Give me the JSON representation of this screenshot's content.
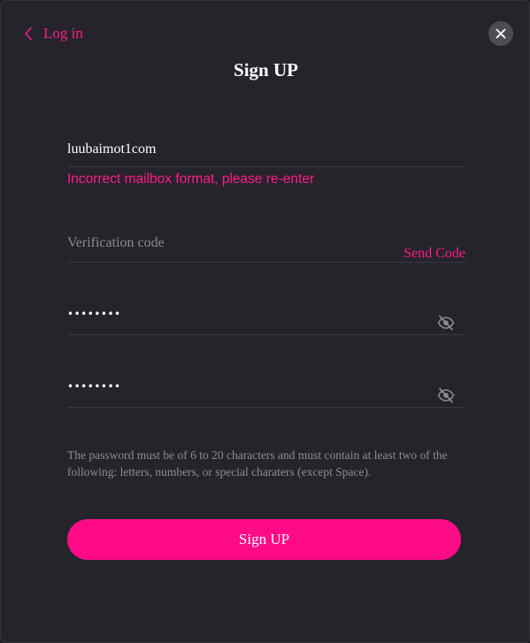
{
  "header": {
    "back_label": "Log in",
    "title": "Sign UP"
  },
  "form": {
    "email_value": "luubaimot1com",
    "email_error": "Incorrect mailbox format, please re-enter",
    "code_placeholder": "Verification code",
    "send_code_label": "Send Code",
    "password_dots": "••••••••",
    "confirm_password_dots": "••••••••",
    "password_hint": "The password must be of 6 to 20 characters and must contain at least two of the following: letters, numbers, or special charaters (except Space).",
    "submit_label": "Sign UP"
  },
  "colors": {
    "accent": "#ff0a87",
    "background": "#25242b",
    "muted_text": "#8c8b92"
  },
  "icons": {
    "back": "chevron-left-icon",
    "close": "close-icon",
    "password_visibility": "eye-off-icon"
  }
}
